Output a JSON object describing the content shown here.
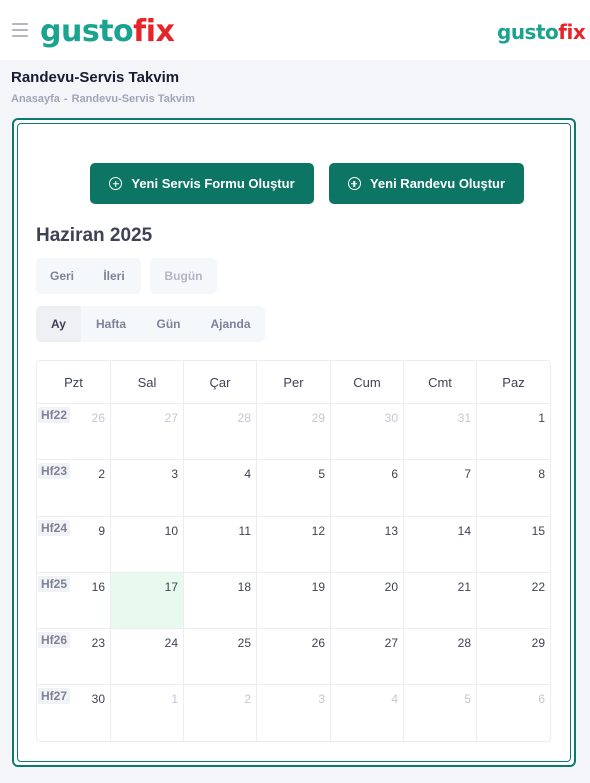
{
  "header": {
    "logo_main_gusto": "gusto",
    "logo_main_fix": "fix",
    "logo_right_gusto": "gusto",
    "logo_right_fix": "fix"
  },
  "page": {
    "title": "Randevu-Servis Takvim",
    "breadcrumb": [
      "Anasayfa",
      "Randevu-Servis Takvim"
    ],
    "breadcrumb_separator": "-"
  },
  "actions": {
    "new_service_form": "Yeni Servis Formu Oluştur",
    "new_appointment": "Yeni Randevu Oluştur"
  },
  "calendar": {
    "title": "Haziran 2025",
    "nav": {
      "prev": "Geri",
      "next": "İleri",
      "today": "Bugün"
    },
    "views": [
      "Ay",
      "Hafta",
      "Gün",
      "Ajanda"
    ],
    "active_view": "Ay",
    "weekdays": [
      "Pzt",
      "Sal",
      "Çar",
      "Per",
      "Cum",
      "Cmt",
      "Paz"
    ],
    "weeks": [
      {
        "label": "Hf22",
        "days": [
          {
            "n": "26",
            "other": true
          },
          {
            "n": "27",
            "other": true
          },
          {
            "n": "28",
            "other": true
          },
          {
            "n": "29",
            "other": true
          },
          {
            "n": "30",
            "other": true
          },
          {
            "n": "31",
            "other": true
          },
          {
            "n": "1"
          }
        ]
      },
      {
        "label": "Hf23",
        "days": [
          {
            "n": "2"
          },
          {
            "n": "3"
          },
          {
            "n": "4"
          },
          {
            "n": "5"
          },
          {
            "n": "6"
          },
          {
            "n": "7"
          },
          {
            "n": "8"
          }
        ]
      },
      {
        "label": "Hf24",
        "days": [
          {
            "n": "9"
          },
          {
            "n": "10"
          },
          {
            "n": "11"
          },
          {
            "n": "12"
          },
          {
            "n": "13"
          },
          {
            "n": "14"
          },
          {
            "n": "15"
          }
        ]
      },
      {
        "label": "Hf25",
        "days": [
          {
            "n": "16"
          },
          {
            "n": "17",
            "today": true
          },
          {
            "n": "18"
          },
          {
            "n": "19"
          },
          {
            "n": "20"
          },
          {
            "n": "21"
          },
          {
            "n": "22"
          }
        ]
      },
      {
        "label": "Hf26",
        "days": [
          {
            "n": "23"
          },
          {
            "n": "24"
          },
          {
            "n": "25"
          },
          {
            "n": "26"
          },
          {
            "n": "27"
          },
          {
            "n": "28"
          },
          {
            "n": "29"
          }
        ]
      },
      {
        "label": "Hf27",
        "days": [
          {
            "n": "30"
          },
          {
            "n": "1",
            "other": true
          },
          {
            "n": "2",
            "other": true
          },
          {
            "n": "3",
            "other": true
          },
          {
            "n": "4",
            "other": true
          },
          {
            "n": "5",
            "other": true
          },
          {
            "n": "6",
            "other": true
          }
        ]
      }
    ]
  },
  "colors": {
    "brand_teal": "#0c7563",
    "logo_green": "#1aa38f",
    "logo_red": "#e8242b",
    "today_highlight": "#e8f9ee"
  }
}
